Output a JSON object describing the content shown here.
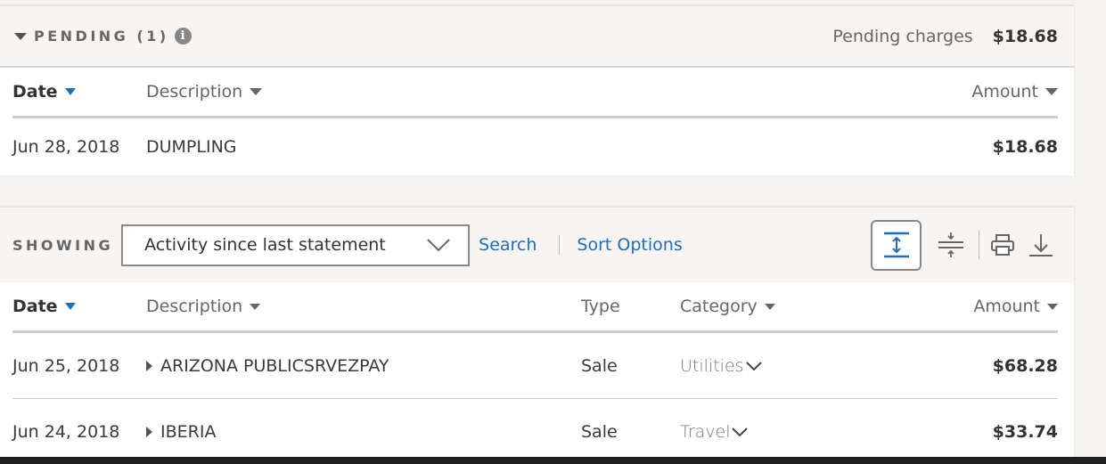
{
  "pending": {
    "title": "PENDING (1)",
    "charges_label": "Pending charges",
    "charges_value": "$18.68",
    "columns": {
      "date": "Date",
      "description": "Description",
      "amount": "Amount"
    },
    "rows": [
      {
        "date": "Jun 28, 2018",
        "description": "DUMPLING",
        "amount": "$18.68"
      }
    ]
  },
  "activity": {
    "showing_label": "SHOWING",
    "filter_selected": "Activity since last statement",
    "search_link": "Search",
    "sort_options_link": "Sort Options",
    "tools": [
      "expand-rows-icon",
      "collapse-rows-icon",
      "print-icon",
      "download-icon"
    ],
    "columns": {
      "date": "Date",
      "description": "Description",
      "type": "Type",
      "category": "Category",
      "amount": "Amount"
    },
    "rows": [
      {
        "date": "Jun 25, 2018",
        "description": "ARIZONA PUBLICSRVEZPAY",
        "type": "Sale",
        "category": "Utilities",
        "amount": "$68.28"
      },
      {
        "date": "Jun 24, 2018",
        "description": "IBERIA",
        "type": "Sale",
        "category": "Travel",
        "amount": "$33.74"
      }
    ]
  },
  "colors": {
    "accent": "#1b6fc1",
    "header_bg": "#f7f4f1",
    "page_bg": "#f5f3f0"
  }
}
